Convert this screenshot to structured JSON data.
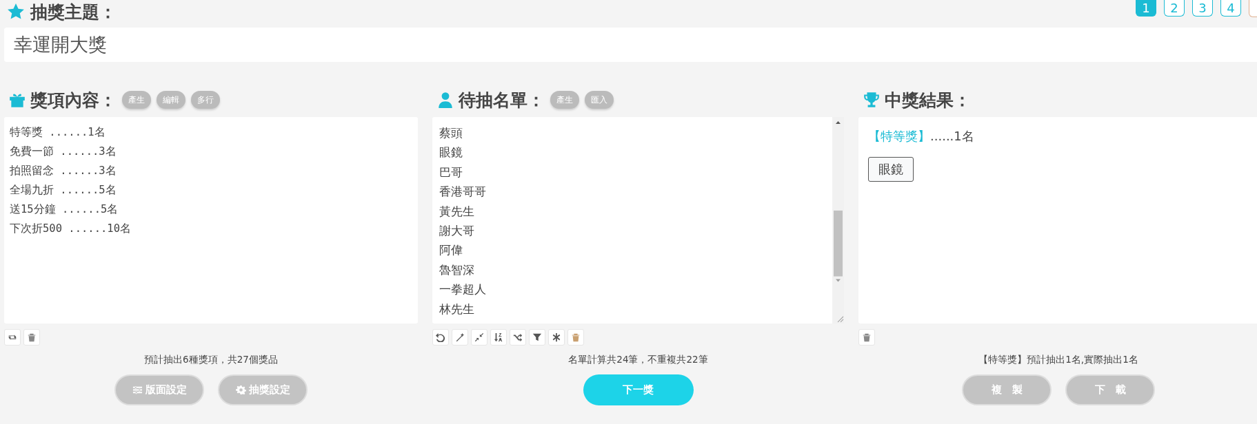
{
  "theme": {
    "label": "抽獎主題：",
    "value": "幸運開大獎"
  },
  "pages": [
    {
      "label": "1",
      "selected": true
    },
    {
      "label": "2",
      "selected": false
    },
    {
      "label": "3",
      "selected": false
    },
    {
      "label": "4",
      "selected": false
    }
  ],
  "prizes": {
    "title": "獎項內容：",
    "chips": [
      "產生",
      "編輯",
      "多行"
    ],
    "lines": [
      "特等獎 ......1名",
      "免費一節 ......3名",
      "拍照留念 ......3名",
      "全場九折 ......5名",
      "送15分鐘 ......5名",
      "下次折500 ......10名"
    ],
    "summary": "預計抽出6種獎項，共27個獎品",
    "buttons": [
      "版面設定",
      "抽獎設定"
    ]
  },
  "names": {
    "title": "待抽名單：",
    "chips": [
      "產生",
      "匯入"
    ],
    "lines": [
      "蔡頭",
      "眼鏡",
      "巴哥",
      "香港哥哥",
      "黃先生",
      "謝大哥",
      "阿偉",
      "魯智深",
      "一拳超人",
      "林先生"
    ],
    "summary": "名單計算共24筆，不重複共22筆",
    "next_button": "下一獎"
  },
  "results": {
    "title": "中獎結果：",
    "prize_label": "【特等獎】",
    "prize_count": "......1名",
    "winners": [
      "眼鏡"
    ],
    "summary": "【特等獎】預計抽出1名,實際抽出1名",
    "buttons": [
      "複　製",
      "下　載"
    ]
  }
}
